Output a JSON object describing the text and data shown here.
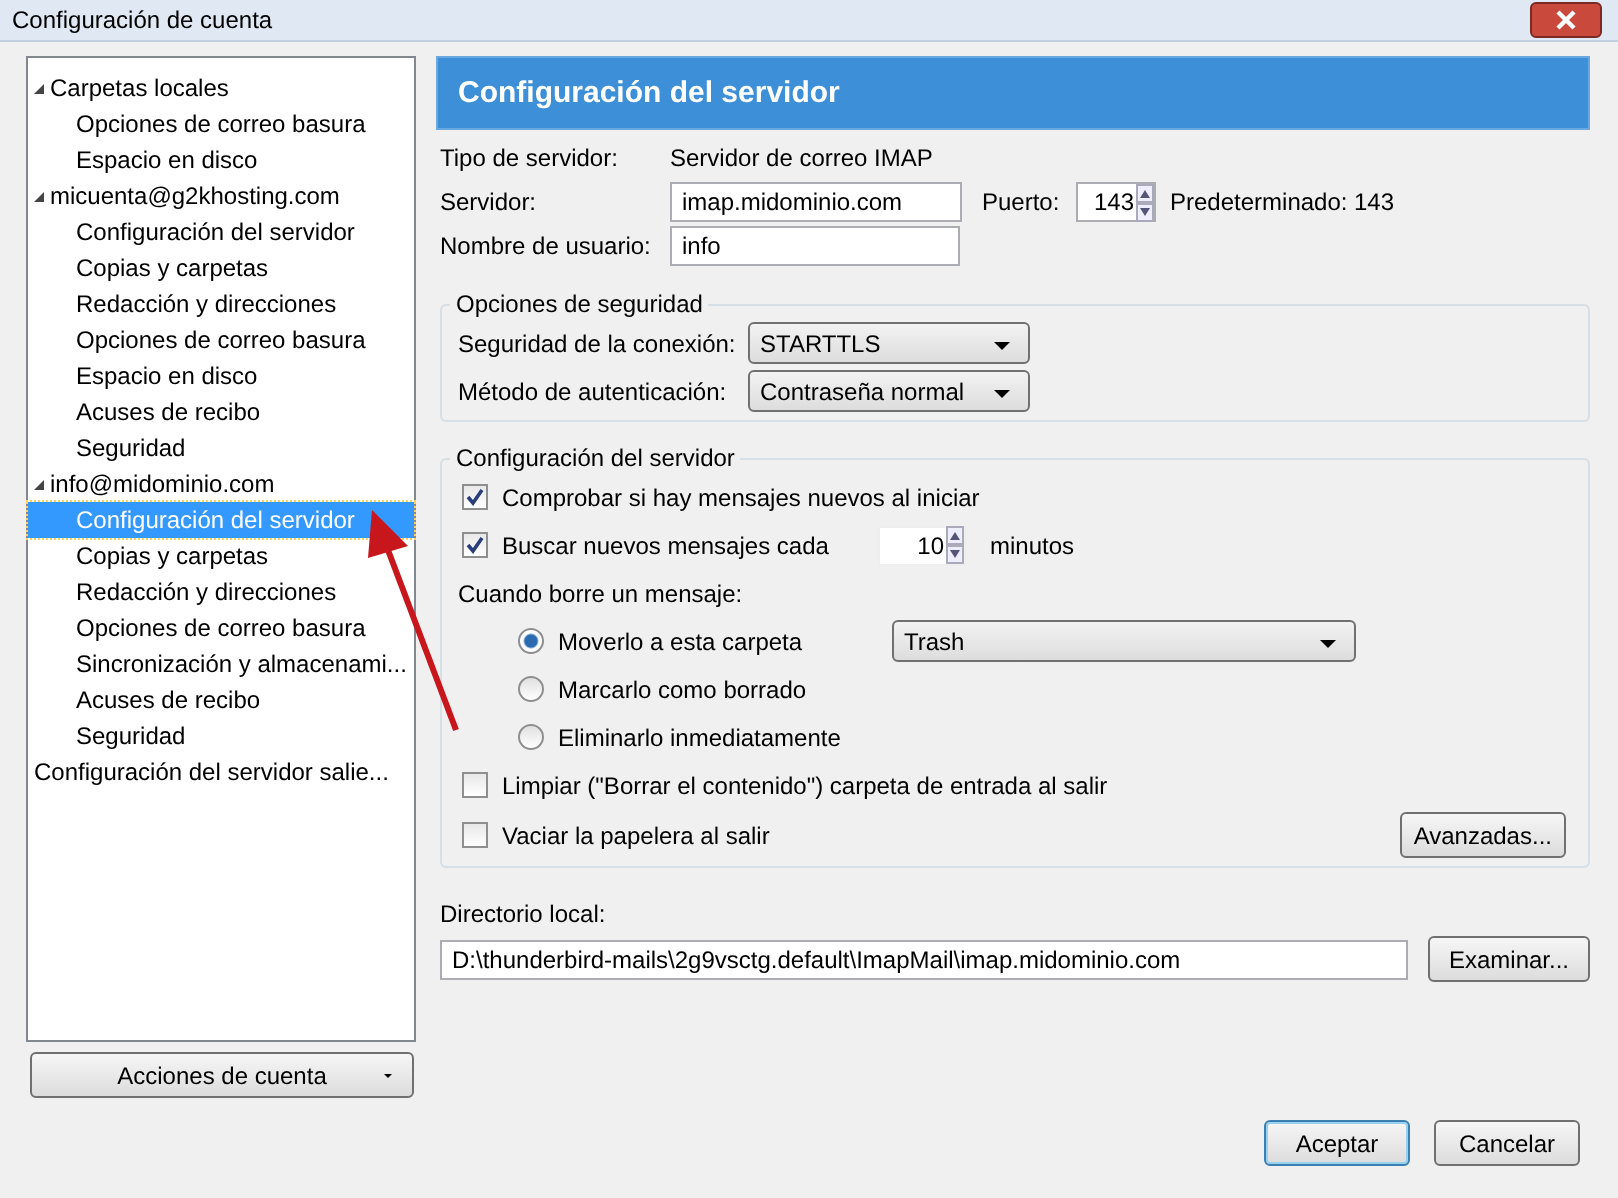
{
  "window": {
    "title": "Configuración de cuenta"
  },
  "sidebar": {
    "tree": [
      {
        "label": "Carpetas locales",
        "expanded": true,
        "selected": false,
        "children": [
          {
            "label": "Opciones de correo basura",
            "selected": false
          },
          {
            "label": "Espacio en disco",
            "selected": false
          }
        ]
      },
      {
        "label": "micuenta@g2khosting.com",
        "expanded": true,
        "selected": false,
        "children": [
          {
            "label": "Configuración del servidor",
            "selected": false
          },
          {
            "label": "Copias y carpetas",
            "selected": false
          },
          {
            "label": "Redacción y direcciones",
            "selected": false
          },
          {
            "label": "Opciones de correo basura",
            "selected": false
          },
          {
            "label": "Espacio en disco",
            "selected": false
          },
          {
            "label": "Acuses de recibo",
            "selected": false
          },
          {
            "label": "Seguridad",
            "selected": false
          }
        ]
      },
      {
        "label": "info@midominio.com",
        "expanded": true,
        "selected": false,
        "children": [
          {
            "label": "Configuración del servidor",
            "selected": true
          },
          {
            "label": "Copias y carpetas",
            "selected": false
          },
          {
            "label": "Redacción y direcciones",
            "selected": false
          },
          {
            "label": "Opciones de correo basura",
            "selected": false
          },
          {
            "label": "Sincronización y almacenami...",
            "selected": false
          },
          {
            "label": "Acuses de recibo",
            "selected": false
          },
          {
            "label": "Seguridad",
            "selected": false
          }
        ]
      },
      {
        "label": "Configuración del servidor salie...",
        "selected": false
      }
    ],
    "actions_button": "Acciones de cuenta"
  },
  "panel": {
    "header": "Configuración del servidor",
    "server_type": {
      "label": "Tipo de servidor:",
      "value": "Servidor de correo IMAP"
    },
    "server": {
      "label": "Servidor:",
      "value": "imap.midominio.com"
    },
    "port": {
      "label": "Puerto:",
      "value": "143",
      "default_label": "Predeterminado:",
      "default_value": "143"
    },
    "username": {
      "label": "Nombre de usuario:",
      "value": "info"
    },
    "security": {
      "title": "Opciones de seguridad",
      "fields": [
        {
          "label": "Seguridad de la conexión:",
          "value": "STARTTLS"
        },
        {
          "label": "Método de autenticación:",
          "value": "Contraseña normal"
        }
      ]
    },
    "server_settings": {
      "title": "Configuración del servidor",
      "check_startup": {
        "label": "Comprobar si hay mensajes nuevos al iniciar",
        "checked": true
      },
      "check_every": {
        "label": "Buscar nuevos mensajes cada",
        "checked": true,
        "value": "10",
        "unit": "minutos"
      },
      "delete_label": "Cuando borre un mensaje:",
      "delete_options": [
        {
          "label": "Moverlo a esta carpeta",
          "selected": true,
          "folder": "Trash"
        },
        {
          "label": "Marcarlo como borrado",
          "selected": false
        },
        {
          "label": "Eliminarlo inmediatamente",
          "selected": false
        }
      ],
      "exit_options": [
        {
          "label": "Limpiar (\"Borrar el contenido\") carpeta de entrada al salir",
          "checked": false
        },
        {
          "label": "Vaciar la papelera al salir",
          "checked": false
        }
      ],
      "advanced_button": "Avanzadas..."
    },
    "local_dir": {
      "label": "Directorio local:",
      "value": "D:\\thunderbird-mails\\2g9vsctg.default\\ImapMail\\imap.midominio.com",
      "browse_button": "Examinar..."
    }
  },
  "buttons": [
    "Aceptar",
    "Cancelar"
  ]
}
